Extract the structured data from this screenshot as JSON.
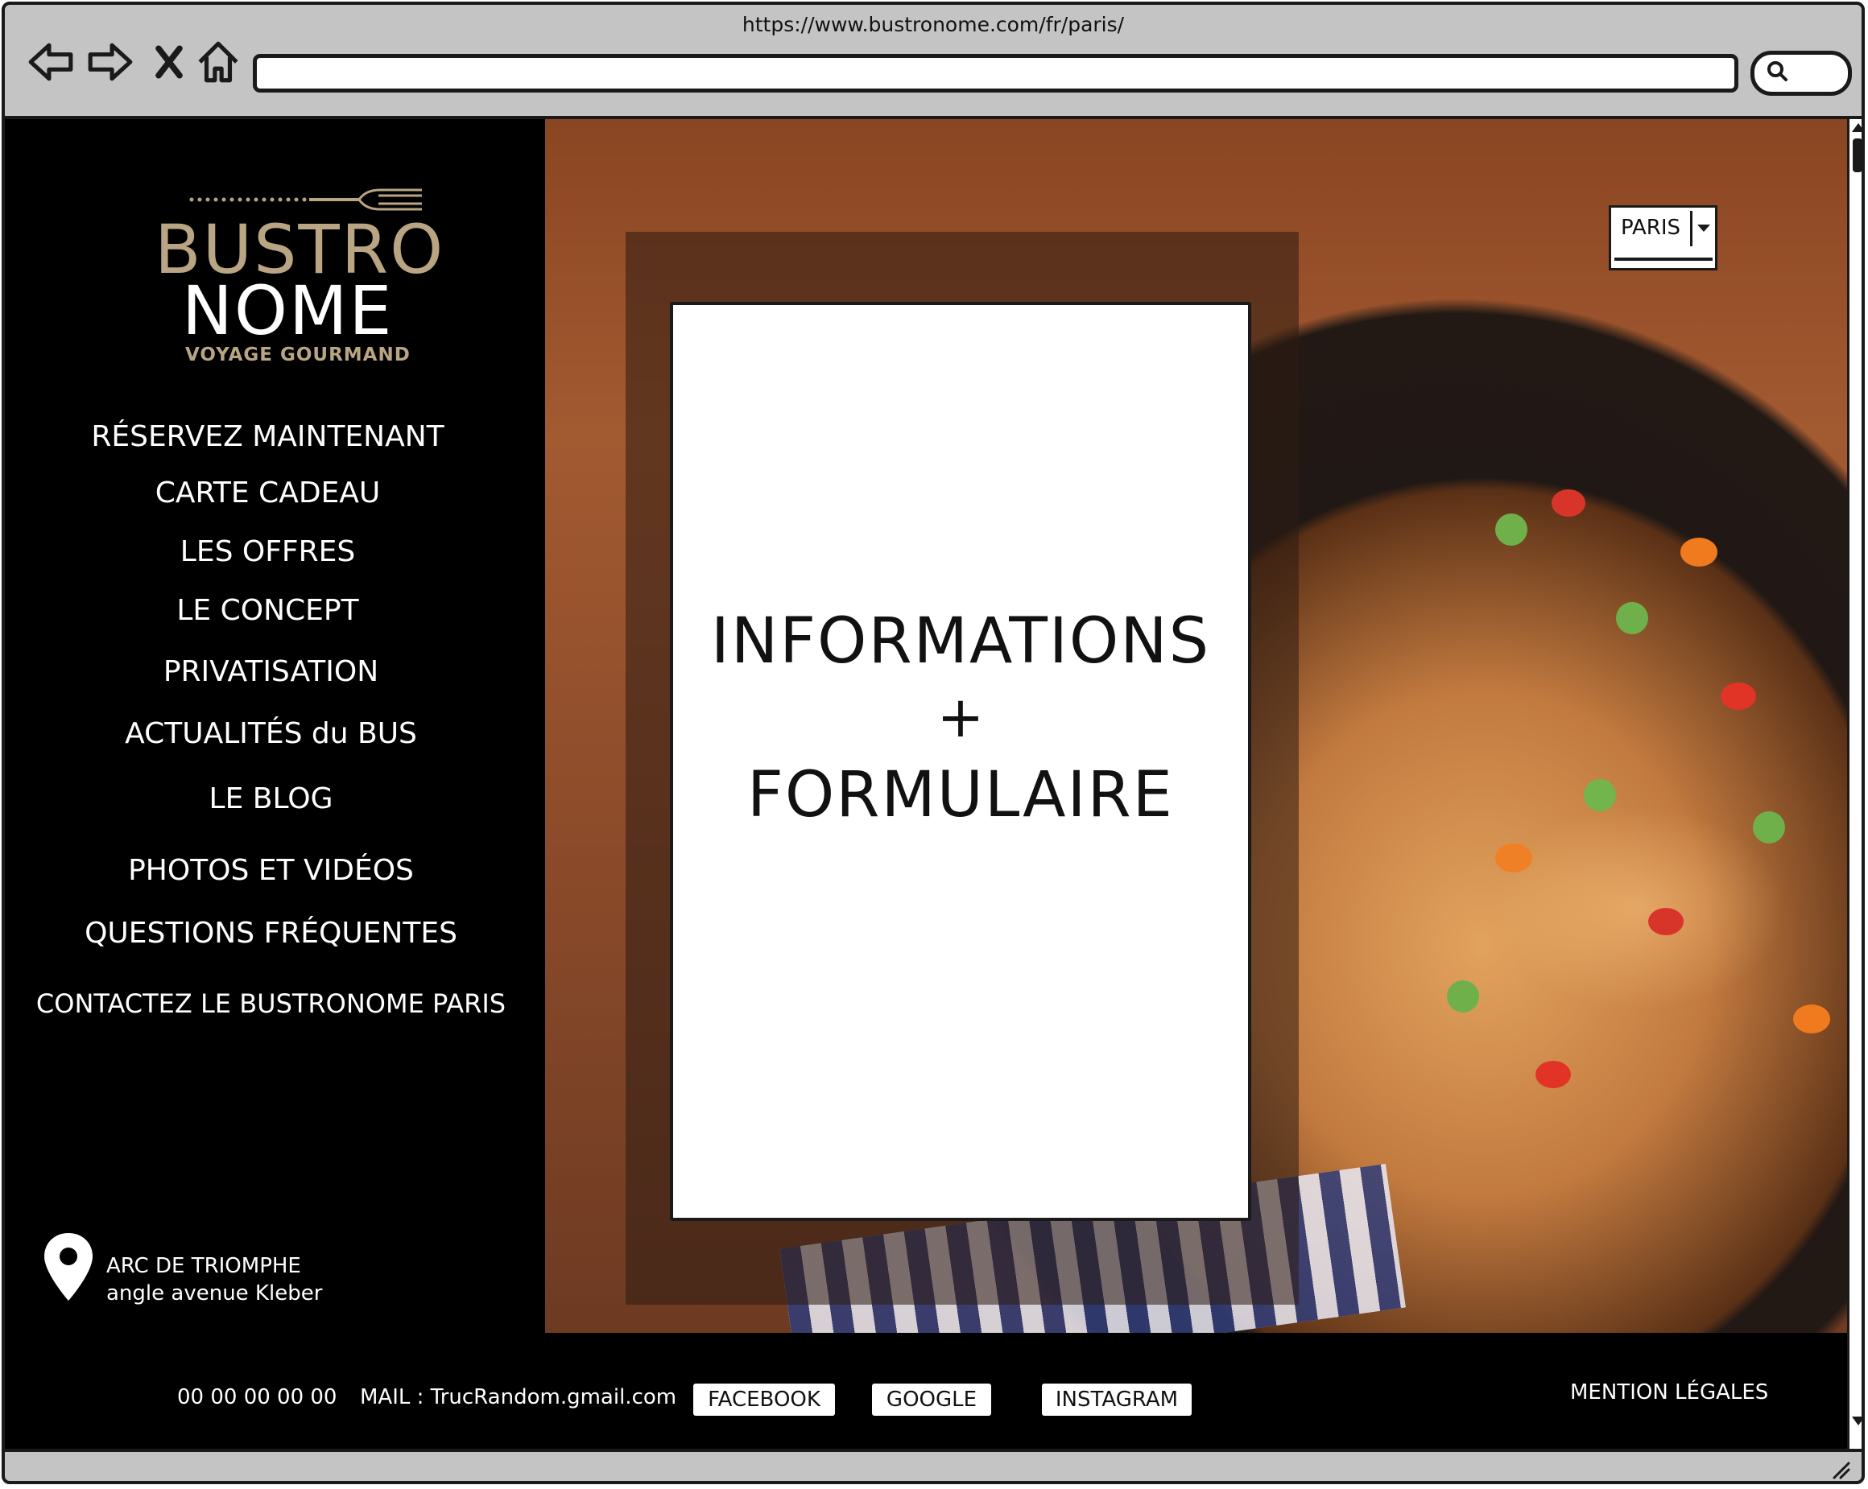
{
  "browser": {
    "url": "https://www.bustronome.com/fr/paris/"
  },
  "logo": {
    "line1": "BUSTRO",
    "line2": "NOME",
    "tagline": "VOYAGE GOURMAND"
  },
  "nav": [
    {
      "label": "RÉSERVEZ MAINTENANT"
    },
    {
      "label": "CARTE CADEAU"
    },
    {
      "label": "LES OFFRES"
    },
    {
      "label": "LE CONCEPT"
    },
    {
      "label": "PRIVATISATION"
    },
    {
      "label": "ACTUALITÉS du BUS"
    },
    {
      "label": "LE BLOG"
    },
    {
      "label": "PHOTOS ET VIDÉOS"
    },
    {
      "label": "QUESTIONS FRÉQUENTES"
    },
    {
      "label": "CONTACTEZ LE BUSTRONOME PARIS"
    }
  ],
  "address": {
    "line1": "ARC DE TRIOMPHE",
    "line2": "angle avenue Kleber"
  },
  "card": {
    "line1": "INFORMATIONS",
    "line2": "+",
    "line3": "FORMULAIRE"
  },
  "city_select": {
    "value": "PARIS"
  },
  "footer": {
    "phone": "00 00 00 00 00",
    "mail": "MAIL : TrucRandom.gmail.com",
    "facebook": "FACEBOOK",
    "google": "GOOGLE",
    "instagram": "INSTAGRAM",
    "legal": "MENTION LÉGALES"
  },
  "colors": {
    "logo_gold": "#b9a584",
    "sidebar_bg": "#000000",
    "chrome_gray": "#c4c4c4"
  }
}
